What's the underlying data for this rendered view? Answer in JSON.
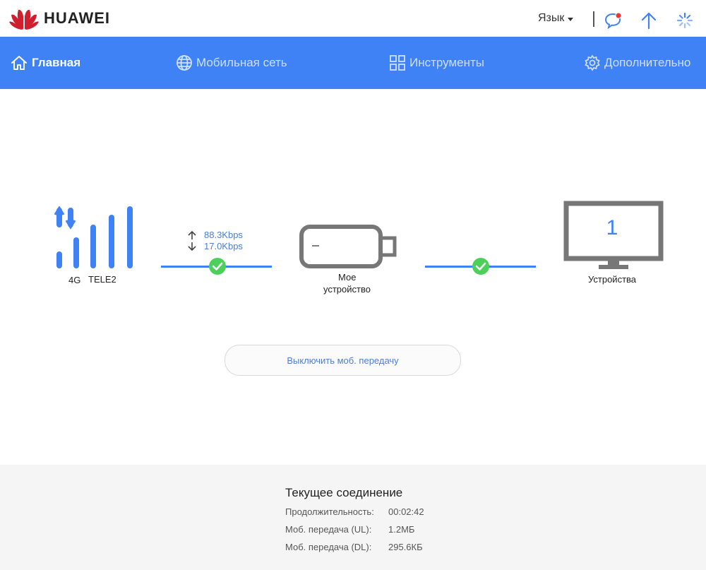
{
  "brand": {
    "name": "HUAWEI",
    "logo_color": "#cf1f2f"
  },
  "header": {
    "language_label": "Язык",
    "icons": [
      "message-icon",
      "upload-arrow-icon",
      "loading-spinner-icon"
    ]
  },
  "nav": {
    "accent": "#3f82f5",
    "items": [
      {
        "label": "Главная",
        "icon": "home-icon",
        "active": true
      },
      {
        "label": "Мобильная сеть",
        "icon": "globe-icon",
        "active": false
      },
      {
        "label": "Инструменты",
        "icon": "tools-grid-icon",
        "active": false
      },
      {
        "label": "Дополнительно",
        "icon": "gear-icon",
        "active": false
      }
    ]
  },
  "network": {
    "type": "4G",
    "operator": "TELE2",
    "upload_speed": "88.3Kbps",
    "download_speed": "17.0Kbps"
  },
  "device": {
    "label_line1": "Мое",
    "label_line2": "устройство"
  },
  "clients": {
    "count": "1",
    "label": "Устройства"
  },
  "actions": {
    "toggle_data_label": "Выключить моб. передачу"
  },
  "connection": {
    "title": "Текущее соединение",
    "rows": [
      {
        "label": "Продолжительность:",
        "value": "00:02:42"
      },
      {
        "label": "Моб. передача (UL):",
        "value": "1.2МБ"
      },
      {
        "label": "Моб. передача (DL):",
        "value": "295.6КБ"
      }
    ]
  }
}
